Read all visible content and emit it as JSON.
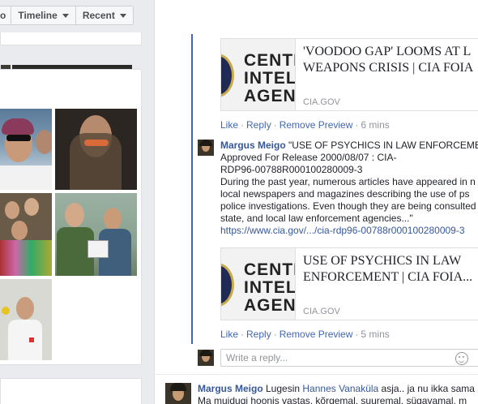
{
  "tabs": [
    {
      "label": "o"
    },
    {
      "label": "Timeline"
    },
    {
      "label": "Recent"
    }
  ],
  "feed": {
    "link_preview_1": {
      "title": "'VOODOO GAP' LOOMS AT L... WEAPONS CRISIS | CIA FOIA",
      "title_line1": "'VOODOO GAP' LOOMS AT L",
      "title_line2": "WEAPONS CRISIS | CIA FOIA",
      "domain": "CIA.GOV",
      "logo_lines": [
        "CENTRA",
        "INTEL",
        "AGENCY"
      ]
    },
    "actions_1": {
      "like": "Like",
      "reply": "Reply",
      "remove_preview": "Remove Preview",
      "time": "6 mins"
    },
    "reply": {
      "author": "Margus Meigo",
      "lines": [
        "\"USE OF PSYCHICS IN LAW ENFORCEMENT",
        "Approved For Release 2000/08/07 : CIA-",
        "RDP96-00788R000100280009-3",
        "During the past year, numerous articles have appeared in n",
        "local newspapers and magazines describing the use of ps",
        "police investigations. Even though they are being consulted",
        "state, and local law enforcement agencies...\""
      ],
      "link": "https://www.cia.gov/.../cia-rdp96-00788r000100280009-3"
    },
    "link_preview_2": {
      "title_line1": "USE OF PSYCHICS IN LAW",
      "title_line2": "ENFORCEMENT | CIA FOIA...",
      "domain": "CIA.GOV",
      "logo_lines": [
        "CENTRA",
        "INTEL",
        "AGENCY"
      ]
    },
    "actions_2": {
      "like": "Like",
      "reply": "Reply",
      "remove_preview": "Remove Preview",
      "time": "5 mins"
    },
    "reply_input": {
      "placeholder": "Write a reply..."
    },
    "next_comment": {
      "author": "Margus Meigo",
      "text_start": " Lugesin ",
      "mention": "Hannes Vanaküla",
      "text_end": " asja.. ja nu ikka sama",
      "line2": "Ma muidugi hoonis vastas, kõrgemal, suuremal, sügavamal, m"
    }
  },
  "colors": {
    "brand_blue": "#4267b2",
    "link_blue": "#365899",
    "muted": "#90949c"
  },
  "icons": [
    "caret-down-icon",
    "smiley-icon",
    "cia-seal-icon"
  ]
}
